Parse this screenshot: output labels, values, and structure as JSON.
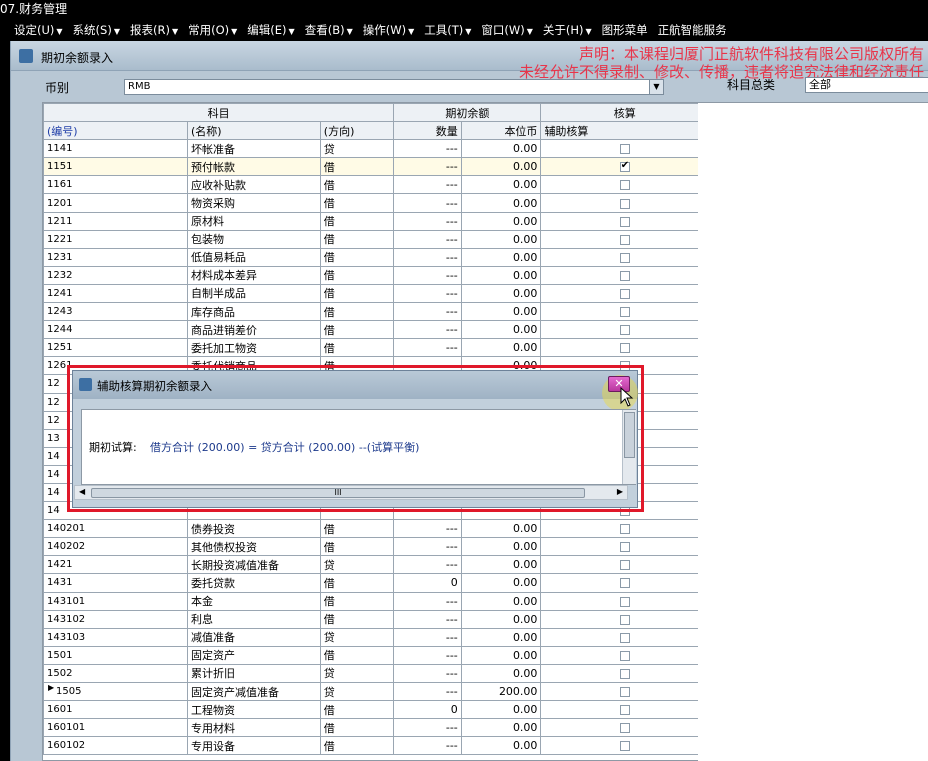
{
  "app": {
    "title": "07.财务管理"
  },
  "menu": [
    {
      "label": "设定(U)"
    },
    {
      "label": "系统(S)"
    },
    {
      "label": "报表(R)"
    },
    {
      "label": "常用(O)"
    },
    {
      "label": "编辑(E)"
    },
    {
      "label": "查看(B)"
    },
    {
      "label": "操作(W)"
    },
    {
      "label": "工具(T)"
    },
    {
      "label": "窗口(W)"
    },
    {
      "label": "关于(H)"
    },
    {
      "label": "图形菜单"
    },
    {
      "label": "正航智能服务"
    }
  ],
  "window": {
    "title": "期初余额录入"
  },
  "notice": {
    "line1": "声明：本课程归厦门正航软件科技有限公司版权所有",
    "line2": "未经允许不得录制、修改、传播，违者将追究法律和经济责任"
  },
  "filters": {
    "currency_label": "币别",
    "currency_value": "RMB",
    "class_label": "科目总类",
    "class_value": "全部"
  },
  "grid": {
    "group_headers": {
      "subject": "科目",
      "opening": "期初余额",
      "check": "核算"
    },
    "columns": {
      "code": "(编号)",
      "name": "(名称)",
      "direction": "(方向)",
      "qty": "数量",
      "amount": "本位币",
      "aux": "辅助核算"
    },
    "rows": [
      {
        "code": "1141",
        "name": "坏帐准备",
        "dir": "贷",
        "qty": "---",
        "amt": "0.00",
        "aux": false
      },
      {
        "code": "1151",
        "name": "预付帐款",
        "dir": "借",
        "qty": "---",
        "amt": "0.00",
        "aux": true,
        "selected": true
      },
      {
        "code": "1161",
        "name": "应收补贴款",
        "dir": "借",
        "qty": "---",
        "amt": "0.00",
        "aux": false
      },
      {
        "code": "1201",
        "name": "物资采购",
        "dir": "借",
        "qty": "---",
        "amt": "0.00",
        "aux": false
      },
      {
        "code": "1211",
        "name": "原材料",
        "dir": "借",
        "qty": "---",
        "amt": "0.00",
        "aux": false
      },
      {
        "code": "1221",
        "name": "包装物",
        "dir": "借",
        "qty": "---",
        "amt": "0.00",
        "aux": false
      },
      {
        "code": "1231",
        "name": "低值易耗品",
        "dir": "借",
        "qty": "---",
        "amt": "0.00",
        "aux": false
      },
      {
        "code": "1232",
        "name": "材料成本差异",
        "dir": "借",
        "qty": "---",
        "amt": "0.00",
        "aux": false
      },
      {
        "code": "1241",
        "name": "自制半成品",
        "dir": "借",
        "qty": "---",
        "amt": "0.00",
        "aux": false
      },
      {
        "code": "1243",
        "name": "库存商品",
        "dir": "借",
        "qty": "---",
        "amt": "0.00",
        "aux": false
      },
      {
        "code": "1244",
        "name": "商品进销差价",
        "dir": "借",
        "qty": "---",
        "amt": "0.00",
        "aux": false
      },
      {
        "code": "1251",
        "name": "委托加工物资",
        "dir": "借",
        "qty": "---",
        "amt": "0.00",
        "aux": false
      },
      {
        "code": "1261",
        "name": "委托代销商品",
        "dir": "借",
        "qty": "---",
        "amt": "0.00",
        "aux": false
      },
      {
        "code": "12",
        "name": "",
        "dir": "",
        "qty": "",
        "amt": "",
        "aux": false
      },
      {
        "code": "12",
        "name": "",
        "dir": "",
        "qty": "",
        "amt": "",
        "aux": false
      },
      {
        "code": "12",
        "name": "",
        "dir": "",
        "qty": "",
        "amt": "",
        "aux": false
      },
      {
        "code": "13",
        "name": "",
        "dir": "",
        "qty": "",
        "amt": "",
        "aux": false
      },
      {
        "code": "14",
        "name": "",
        "dir": "",
        "qty": "",
        "amt": "",
        "aux": false
      },
      {
        "code": "14",
        "name": "",
        "dir": "",
        "qty": "",
        "amt": "",
        "aux": false
      },
      {
        "code": "14",
        "name": "",
        "dir": "",
        "qty": "",
        "amt": "",
        "aux": false
      },
      {
        "code": "14",
        "name": "",
        "dir": "",
        "qty": "",
        "amt": "",
        "aux": false
      },
      {
        "code": "140201",
        "name": "债券投资",
        "dir": "借",
        "qty": "---",
        "amt": "0.00",
        "aux": false
      },
      {
        "code": "140202",
        "name": "其他债权投资",
        "dir": "借",
        "qty": "---",
        "amt": "0.00",
        "aux": false
      },
      {
        "code": "1421",
        "name": "长期投资减值准备",
        "dir": "贷",
        "qty": "---",
        "amt": "0.00",
        "aux": false
      },
      {
        "code": "1431",
        "name": "委托贷款",
        "dir": "借",
        "qty": "0",
        "amt": "0.00",
        "aux": false
      },
      {
        "code": "143101",
        "name": "本金",
        "dir": "借",
        "qty": "---",
        "amt": "0.00",
        "aux": false
      },
      {
        "code": "143102",
        "name": "利息",
        "dir": "借",
        "qty": "---",
        "amt": "0.00",
        "aux": false
      },
      {
        "code": "143103",
        "name": "减值准备",
        "dir": "贷",
        "qty": "---",
        "amt": "0.00",
        "aux": false
      },
      {
        "code": "1501",
        "name": "固定资产",
        "dir": "借",
        "qty": "---",
        "amt": "0.00",
        "aux": false
      },
      {
        "code": "1502",
        "name": "累计折旧",
        "dir": "贷",
        "qty": "---",
        "amt": "0.00",
        "aux": false
      },
      {
        "code": "1505",
        "name": "固定资产减值准备",
        "dir": "贷",
        "qty": "---",
        "amt": "200.00",
        "aux": false,
        "current": true
      },
      {
        "code": "1601",
        "name": "工程物资",
        "dir": "借",
        "qty": "0",
        "amt": "0.00",
        "aux": false
      },
      {
        "code": "160101",
        "name": "专用材料",
        "dir": "借",
        "qty": "---",
        "amt": "0.00",
        "aux": false
      },
      {
        "code": "160102",
        "name": "专用设备",
        "dir": "借",
        "qty": "---",
        "amt": "0.00",
        "aux": false
      }
    ]
  },
  "dialog": {
    "title": "辅助核算期初余额录入",
    "result_label": "期初试算:",
    "result_text": "借方合计 (200.00) = 贷方合计 (200.00) --(试算平衡)",
    "scroll_grip": "III"
  },
  "colors": {
    "notice": "#e8354a",
    "highlight_border": "#e0182a",
    "result_text": "#1d3a8c"
  }
}
